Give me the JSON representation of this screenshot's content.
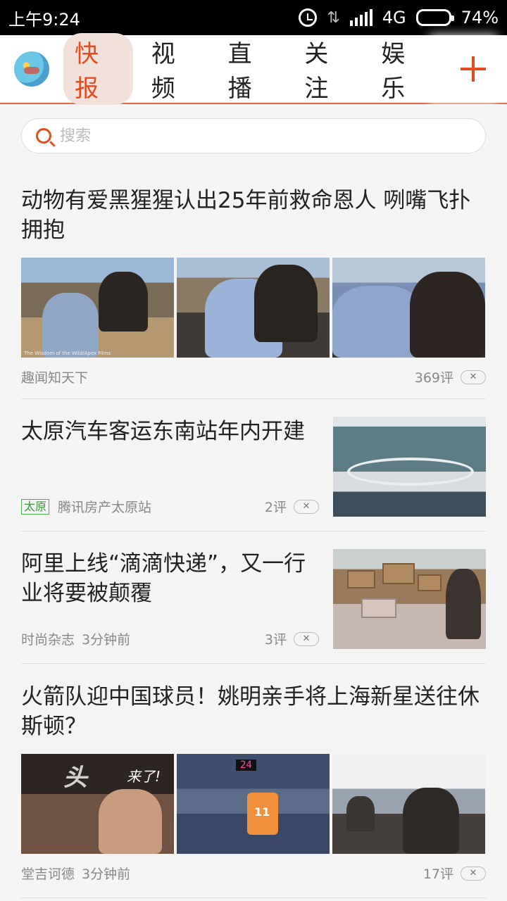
{
  "status_bar": {
    "time": "上午9:24",
    "network": "4G",
    "battery": "74%",
    "battery_level": 0.74
  },
  "tabs": {
    "items": [
      "快报",
      "视频",
      "直播",
      "关注",
      "娱乐"
    ],
    "active_index": 0,
    "add_icon": "plus-icon",
    "accent_color": "#e34c1e"
  },
  "search": {
    "placeholder": "搜索"
  },
  "feed": [
    {
      "title": "动物有爱黑猩猩认出25年前救命恩人 咧嘴飞扑拥抱",
      "source": "趣闻知天下",
      "comments": "369评",
      "dismiss": "✕",
      "watermark": "The Wisdom of the Wild/Apex Films"
    },
    {
      "title": "太原汽车客运东南站年内开建",
      "tag": "太原",
      "source": "腾讯房产太原站",
      "comments": "2评",
      "dismiss": "✕"
    },
    {
      "title": "阿里上线“滴滴快递”，又一行业将要被颠覆",
      "source": "时尚杂志",
      "time": "3分钟前",
      "comments": "3评",
      "dismiss": "✕"
    },
    {
      "title": "火箭队迎中国球员！姚明亲手将上海新星送往休斯顿？",
      "source": "堂吉诃德",
      "time": "3分钟前",
      "comments": "17评",
      "dismiss": "✕",
      "overlay_big": "头",
      "overlay_small": "来了!",
      "scoreboard": "24"
    }
  ]
}
